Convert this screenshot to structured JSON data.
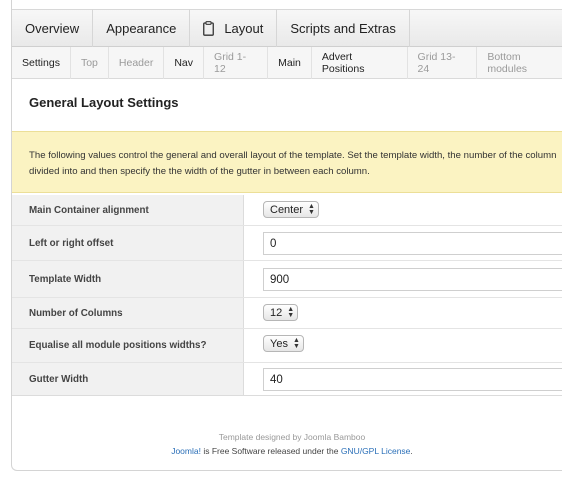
{
  "top_tabs": [
    {
      "label": "Overview",
      "icon": null
    },
    {
      "label": "Appearance",
      "icon": null
    },
    {
      "label": "Layout",
      "icon": "clipboard-icon"
    },
    {
      "label": "Scripts and Extras",
      "icon": null
    }
  ],
  "sub_tabs": [
    {
      "label": "Settings",
      "active": true
    },
    {
      "label": "Top",
      "active": false
    },
    {
      "label": "Header",
      "active": false
    },
    {
      "label": "Nav",
      "active": true
    },
    {
      "label": "Grid 1-12",
      "active": false
    },
    {
      "label": "Main",
      "active": true
    },
    {
      "label": "Advert Positions",
      "active": true
    },
    {
      "label": "Grid 13-24",
      "active": false
    },
    {
      "label": "Bottom modules",
      "active": false
    }
  ],
  "section_title": "General Layout Settings",
  "notice": {
    "line1": "The following values control the general and overall layout of the template. Set the template width, the number of the column",
    "line2": "divided into and then specify the the width of the gutter in between each column."
  },
  "fields": {
    "alignment": {
      "label": "Main Container alignment",
      "value": "Center"
    },
    "offset": {
      "label": "Left or right offset",
      "value": "0"
    },
    "template_width": {
      "label": "Template Width",
      "value": "900"
    },
    "columns": {
      "label": "Number of Columns",
      "value": "12"
    },
    "equalise": {
      "label": "Equalise all module positions widths?",
      "value": "Yes"
    },
    "gutter": {
      "label": "Gutter Width",
      "value": "40"
    }
  },
  "footer": {
    "line1": "Template designed by Joomla Bamboo",
    "joomla_link": "Joomla!",
    "middle": " is Free Software released under the ",
    "license_link": "GNU/GPL License",
    "end": "."
  },
  "colors": {
    "notice_bg": "#fbf3c2",
    "link": "#2a6fb8"
  }
}
